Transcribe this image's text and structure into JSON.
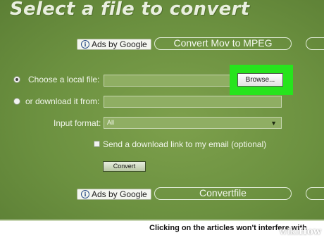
{
  "header": {
    "title": "Select a file to convert"
  },
  "ads_top": {
    "label": "Ads by Google",
    "link": "Convert Mov to MPEG"
  },
  "form": {
    "local_label": "Choose a local file:",
    "download_label": "or download it from:",
    "browse_label": "Browse...",
    "input_format_label": "Input format:",
    "input_format_value": "All",
    "email_label": "Send a download link to my email (optional)",
    "convert_label": "Convert"
  },
  "ads_bottom": {
    "label": "Ads by Google",
    "link": "Convertfile"
  },
  "footer": {
    "text": "Clicking on the articles won't interfere with"
  },
  "watermark": {
    "wiki": "wiki",
    "how": "How"
  },
  "colors": {
    "panel": "#6c9140",
    "highlight": "#27e41d"
  }
}
